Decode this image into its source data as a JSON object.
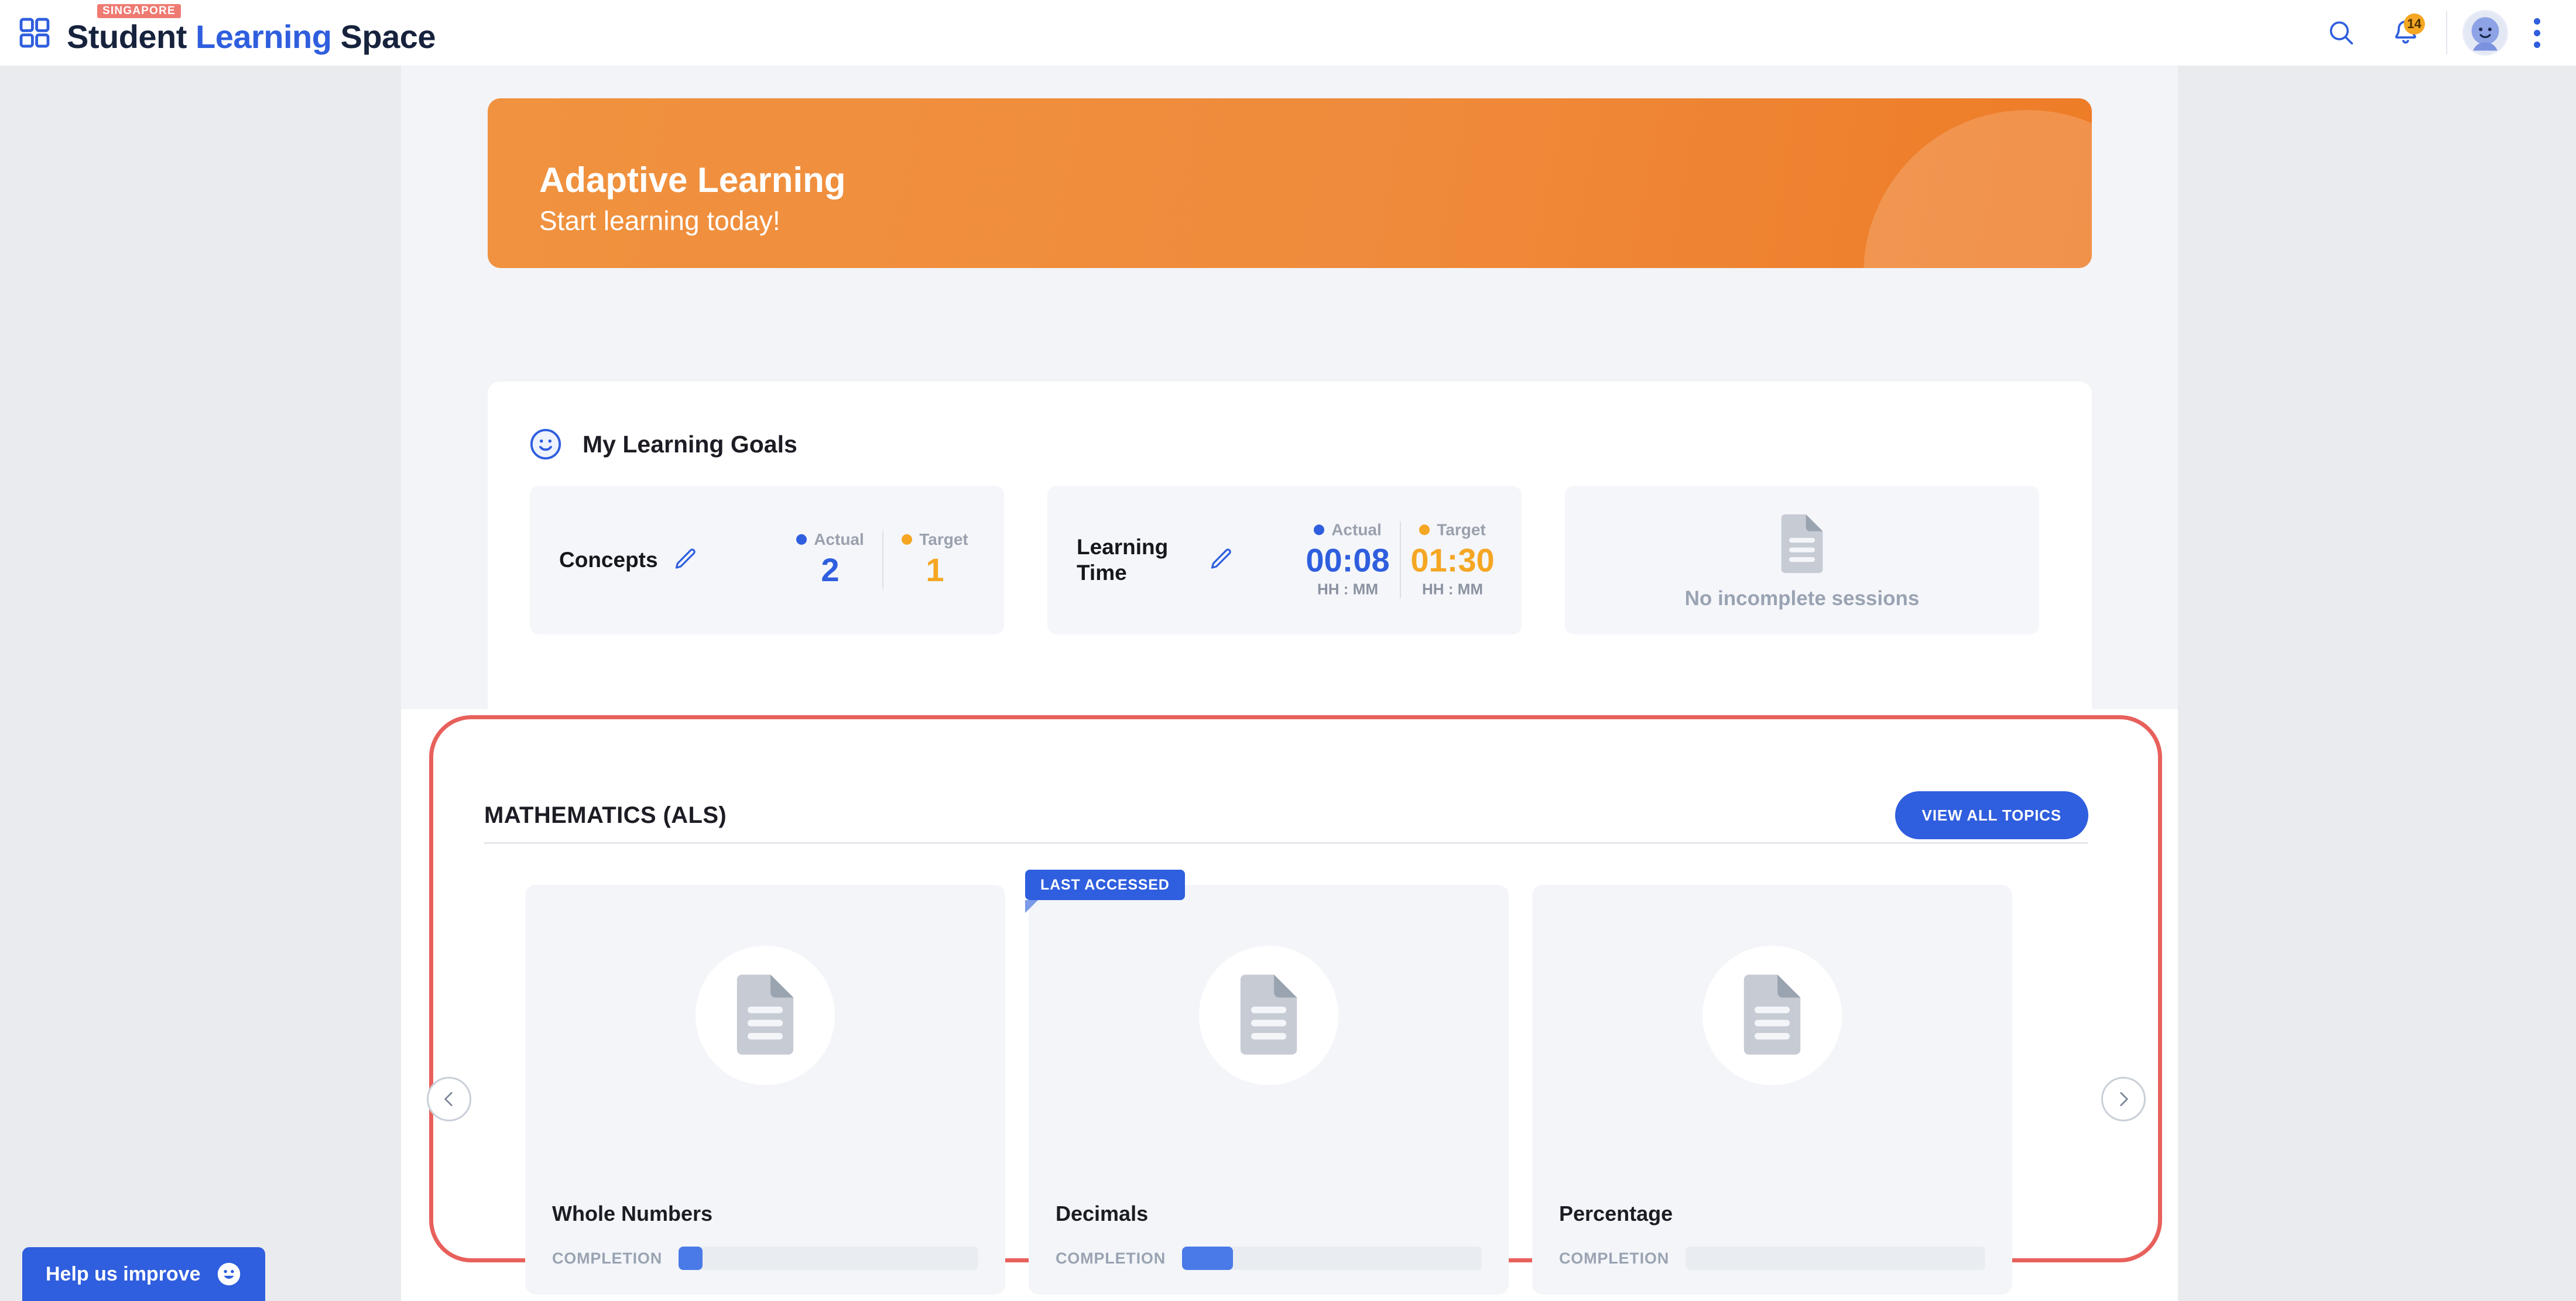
{
  "topbar": {
    "grid_icon": "grid-logo-icon",
    "badge_text": "SINGAPORE",
    "brand_part1": "Student ",
    "brand_part2": "Learning",
    "brand_part3": " Space",
    "search_icon": "search-icon",
    "bell_icon": "bell-icon",
    "notification_count": "14",
    "avatar_icon": "avatar-smiley-icon",
    "kebab_icon": "more-vertical-icon"
  },
  "banner": {
    "title": "Adaptive Learning",
    "subtitle": "Start learning today!",
    "bg_color": "#ef8b3c"
  },
  "goals": {
    "icon": "smiley-face-icon",
    "title": "My Learning Goals",
    "actual_label": "Actual",
    "target_label": "Target",
    "actual_color": "#2f5ede",
    "target_color": "#f5a623",
    "items": [
      {
        "label": "Concepts",
        "edit_icon": "pencil-edit-icon",
        "actual": "2",
        "target": "1",
        "unit": ""
      },
      {
        "label": "Learning Time",
        "edit_icon": "pencil-edit-icon",
        "actual": "00:08",
        "target": "01:30",
        "unit": "HH : MM"
      }
    ],
    "empty_card": {
      "icon": "document-icon",
      "text": "No incomplete sessions"
    }
  },
  "math_section": {
    "title": "MATHEMATICS (ALS)",
    "view_all_label": "VIEW ALL TOPICS",
    "highlight_color": "#e8605c",
    "prev_icon": "chevron-left-icon",
    "next_icon": "chevron-right-icon",
    "completion_label": "COMPLETION",
    "last_accessed_label": "LAST ACCESSED",
    "topics": [
      {
        "name": "Whole Numbers",
        "icon": "document-icon",
        "completion_pct": 8,
        "last_accessed": false
      },
      {
        "name": "Decimals",
        "icon": "document-icon",
        "completion_pct": 17,
        "last_accessed": true
      },
      {
        "name": "Percentage",
        "icon": "document-icon",
        "completion_pct": 0,
        "last_accessed": false
      }
    ]
  },
  "help": {
    "label": "Help us improve",
    "icon": "smiley-face-icon"
  }
}
